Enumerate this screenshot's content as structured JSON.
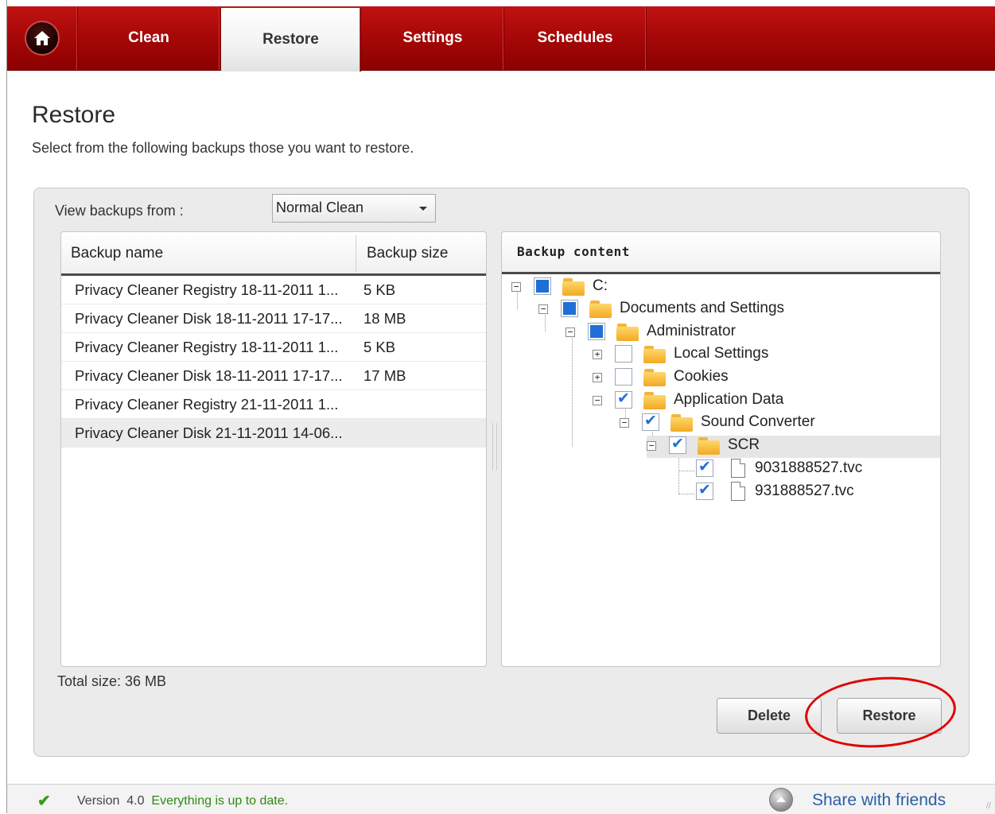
{
  "nav": {
    "home_icon": "home-icon",
    "tabs": [
      {
        "label": "Clean"
      },
      {
        "label": "Restore"
      },
      {
        "label": "Settings"
      },
      {
        "label": "Schedules"
      }
    ]
  },
  "page": {
    "title": "Restore",
    "subtitle": "Select from the following backups those you want to restore."
  },
  "filter": {
    "label": "View backups from :",
    "selected": "Normal Clean"
  },
  "backups": {
    "columns": [
      "Backup name",
      "Backup size"
    ],
    "rows": [
      {
        "name": "Privacy Cleaner Registry 18-11-2011 1...",
        "size": "5 KB"
      },
      {
        "name": "Privacy Cleaner Disk 18-11-2011 17-17...",
        "size": "18 MB"
      },
      {
        "name": "Privacy Cleaner Registry 18-11-2011 1...",
        "size": "5 KB"
      },
      {
        "name": "Privacy Cleaner Disk 18-11-2011 17-17...",
        "size": "17 MB"
      },
      {
        "name": "Privacy Cleaner Registry 21-11-2011 1...",
        "size": ""
      },
      {
        "name": "Privacy Cleaner Disk 21-11-2011 14-06...",
        "size": ""
      }
    ],
    "total": "Total size: 36 MB"
  },
  "content": {
    "header": "Backup content",
    "nodes": [
      {
        "label": "C:"
      },
      {
        "label": "Documents and Settings"
      },
      {
        "label": "Administrator"
      },
      {
        "label": "Local Settings"
      },
      {
        "label": "Cookies"
      },
      {
        "label": "Application Data"
      },
      {
        "label": "Sound Converter"
      },
      {
        "label": "SCR"
      },
      {
        "label": "9031888527.tvc"
      },
      {
        "label": "931888527.tvc"
      }
    ]
  },
  "actions": {
    "delete": "Delete",
    "restore": "Restore"
  },
  "status": {
    "version_label": "Version",
    "version": "4.0",
    "message": "Everything is up to date.",
    "share": "Share with friends"
  },
  "colors": {
    "nav_red": "#a80808",
    "status_ok": "#2e8a12",
    "link_blue": "#2a5fa8",
    "check_blue": "#1f6fd6",
    "annotation": "#e00000"
  }
}
